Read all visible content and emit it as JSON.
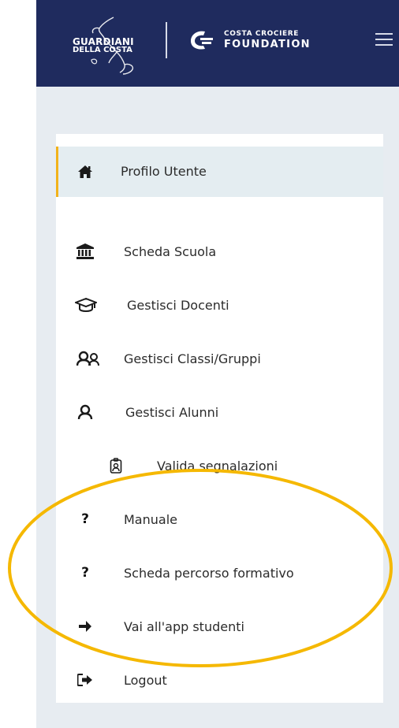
{
  "header": {
    "logo_line1": "GUARDIANI",
    "logo_line2": "DELLA COSTA",
    "partner_line1": "COSTA CROCIERE",
    "partner_line2": "FOUNDATION"
  },
  "colors": {
    "header_bg": "#1f2b5e",
    "sidebar_bg": "#e7ecf1",
    "active_bg": "#e4edf1",
    "active_accent": "#f2b21a",
    "highlight_ellipse": "#f5b800"
  },
  "menu": {
    "items": [
      {
        "label": "Profilo Utente",
        "icon": "home-icon",
        "active": true
      },
      {
        "label": "Scheda Scuola",
        "icon": "institution-icon"
      },
      {
        "label": "Gestisci Docenti",
        "icon": "graduation-cap-icon"
      },
      {
        "label": "Gestisci Classi/Gruppi",
        "icon": "users-icon"
      },
      {
        "label": "Gestisci Alunni",
        "icon": "user-icon"
      },
      {
        "label": "Valida segnalazioni",
        "icon": "badge-icon",
        "sub": true
      },
      {
        "label": "Manuale",
        "icon": "question-icon",
        "icon_glyph": "?"
      },
      {
        "label": "Scheda percorso formativo",
        "icon": "question-icon",
        "icon_glyph": "?"
      },
      {
        "label": "Vai all'app studenti",
        "icon": "arrow-right-icon"
      },
      {
        "label": "Logout",
        "icon": "logout-icon"
      }
    ]
  }
}
